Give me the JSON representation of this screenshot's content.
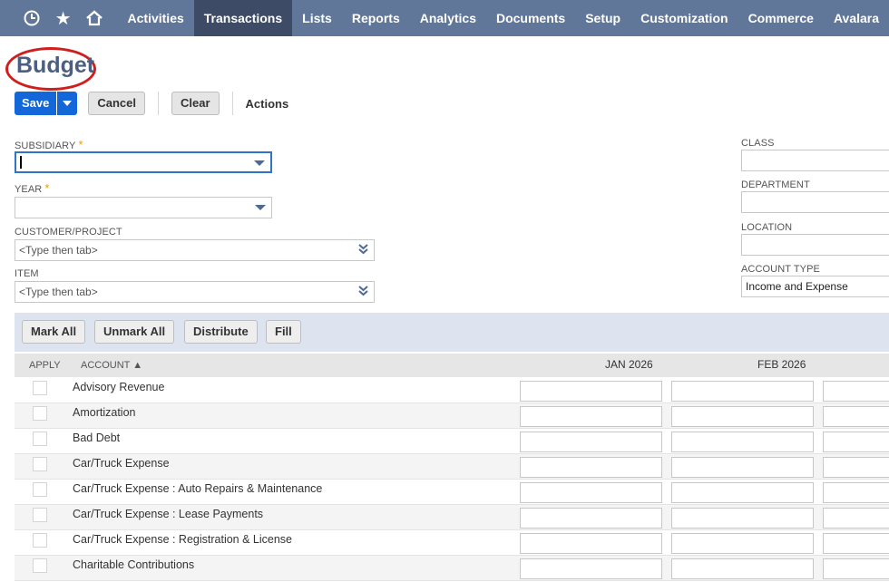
{
  "nav": {
    "items": [
      "Activities",
      "Transactions",
      "Lists",
      "Reports",
      "Analytics",
      "Documents",
      "Setup",
      "Customization",
      "Commerce",
      "Avalara"
    ],
    "active": "Transactions",
    "icons": [
      "recent-records-icon",
      "star-icon",
      "home-icon"
    ]
  },
  "page": {
    "title": "Budget"
  },
  "toolbar": {
    "save": "Save",
    "cancel": "Cancel",
    "clear": "Clear",
    "actions": "Actions"
  },
  "form": {
    "subsidiary": {
      "label": "SUBSIDIARY",
      "value": ""
    },
    "year": {
      "label": "YEAR",
      "value": ""
    },
    "customer_project": {
      "label": "CUSTOMER/PROJECT",
      "placeholder": "<Type then tab>"
    },
    "item": {
      "label": "ITEM",
      "placeholder": "<Type then tab>"
    },
    "class": {
      "label": "CLASS",
      "value": ""
    },
    "department": {
      "label": "DEPARTMENT",
      "value": ""
    },
    "location": {
      "label": "LOCATION",
      "value": ""
    },
    "account_type": {
      "label": "ACCOUNT TYPE",
      "value": "Income and Expense"
    }
  },
  "sublist": {
    "buttons": {
      "mark_all": "Mark All",
      "unmark_all": "Unmark All",
      "distribute": "Distribute",
      "fill": "Fill"
    },
    "headers": {
      "apply": "APPLY",
      "account": "ACCOUNT ▲",
      "months": [
        "JAN 2026",
        "FEB 2026"
      ]
    },
    "rows": [
      "Advisory Revenue",
      "Amortization",
      "Bad Debt",
      "Car/Truck Expense",
      "Car/Truck Expense : Auto Repairs & Maintenance",
      "Car/Truck Expense : Lease Payments",
      "Car/Truck Expense : Registration & License",
      "Charitable Contributions"
    ]
  },
  "colors": {
    "nav_bg": "#607799",
    "nav_active": "#3d4b66",
    "save_blue": "#1467d8",
    "title": "#4d5f80",
    "highlight_ring": "#d01e1e"
  }
}
